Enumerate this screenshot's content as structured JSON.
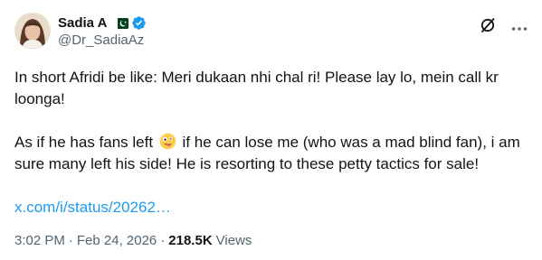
{
  "author": {
    "display_name": "Sadia A",
    "handle": "@Dr_SadiaAz",
    "flag_icon": "pakistan-flag-icon",
    "verified_icon": "verified-badge-icon",
    "avatar_icon": "profile-avatar",
    "verified_color": "#1d9bf0"
  },
  "header_actions": {
    "grok_icon": "grok-icon",
    "more_icon": "more-options-icon"
  },
  "tweet": {
    "line1": "In short Afridi be like: Meri dukaan nhi chal ri! Please lay lo, mein call kr loonga!",
    "line2_before_emoji": "As if he has fans left ",
    "emoji_icon": "zany-face-emoji",
    "line2_after_emoji": " if he can lose me (who was a mad blind fan), i am sure many left his side! He is resorting to these petty tactics for sale!",
    "link": "x.com/i/status/20262…",
    "link_color": "#1d9bf0"
  },
  "meta": {
    "time": "3:02 PM",
    "separator": "·",
    "date": "Feb 24, 2026",
    "views_count": "218.5K",
    "views_label": "Views"
  }
}
